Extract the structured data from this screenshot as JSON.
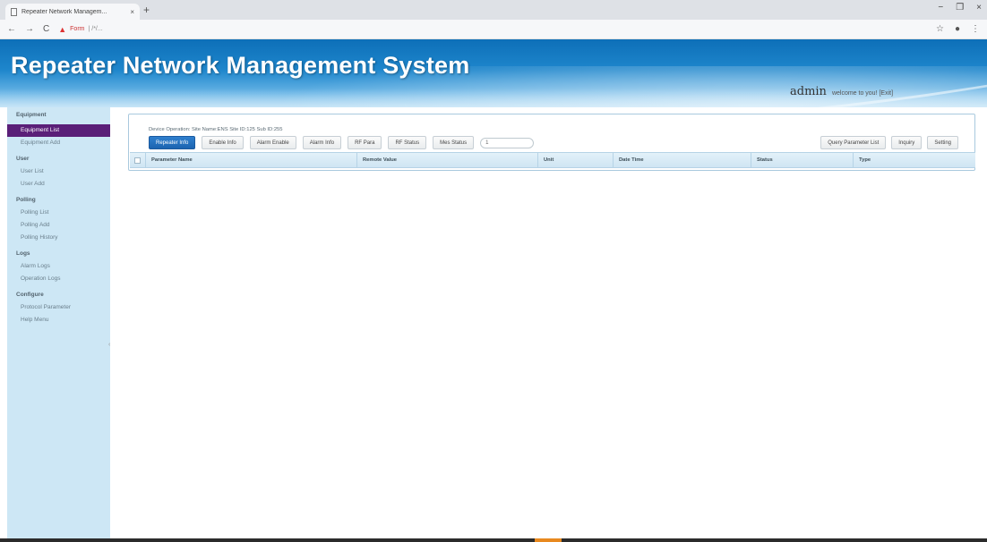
{
  "browser": {
    "tab_title": "Repeater Network Managem...",
    "tab_close": "×",
    "new_tab": "+",
    "nav_back": "←",
    "nav_forward": "→",
    "reload": "C",
    "warning_icon": "▲",
    "security_label": "Form",
    "url": "| /*/...",
    "star": "☆",
    "account": "●",
    "menu": "⋮",
    "win_min": "−",
    "win_max": "❐",
    "win_close": "×"
  },
  "header": {
    "title": "Repeater Network Management System",
    "user": "admin",
    "welcome": "welcome to you! [Exit]"
  },
  "sidebar": {
    "items": [
      {
        "label": "Equipment",
        "type": "head"
      },
      {
        "label": "Equipment List",
        "type": "active"
      },
      {
        "label": "Equipment Add",
        "type": "item"
      },
      {
        "label": "User",
        "type": "head"
      },
      {
        "label": "User List",
        "type": "item"
      },
      {
        "label": "User Add",
        "type": "item"
      },
      {
        "label": "Polling",
        "type": "head"
      },
      {
        "label": "Polling List",
        "type": "item"
      },
      {
        "label": "Polling Add",
        "type": "item"
      },
      {
        "label": "Polling History",
        "type": "item"
      },
      {
        "label": "Logs",
        "type": "head"
      },
      {
        "label": "Alarm Logs",
        "type": "item"
      },
      {
        "label": "Operation Logs",
        "type": "item"
      },
      {
        "label": "Configure",
        "type": "head"
      },
      {
        "label": "Protocol Parameter",
        "type": "item"
      },
      {
        "label": "Help Menu",
        "type": "item"
      }
    ],
    "collapse_handle": "‹"
  },
  "main": {
    "device_info": "Device Operation: Site Name:ENS Site ID:125 Sub ID:255",
    "tabs": [
      {
        "label": "Repeater Info",
        "primary": true
      },
      {
        "label": "Enable Info",
        "primary": false
      },
      {
        "label": "Alarm Enable",
        "primary": false
      },
      {
        "label": "Alarm Info",
        "primary": false
      },
      {
        "label": "RF Para",
        "primary": false
      },
      {
        "label": "RF Status",
        "primary": false
      }
    ],
    "mes_status_label": "Mes Status",
    "mes_status_value": "1",
    "actions": {
      "query_param_list": "Query Parameter List",
      "inquiry": "Inquiry",
      "setting": "Setting"
    },
    "table": {
      "columns": [
        {
          "label": "Parameter Name",
          "width": 236
        },
        {
          "label": "Remote Value",
          "width": 202
        },
        {
          "label": "Unit",
          "width": 84
        },
        {
          "label": "Date Time",
          "width": 154
        },
        {
          "label": "Status",
          "width": 114
        },
        {
          "label": "Type",
          "width": 90
        }
      ]
    }
  },
  "colors": {
    "sidebar_bg": "#cde7f5",
    "sidebar_active": "#5a1f78",
    "primary_button": "#2f7fce",
    "banner_blue": "#0d6fb8"
  }
}
